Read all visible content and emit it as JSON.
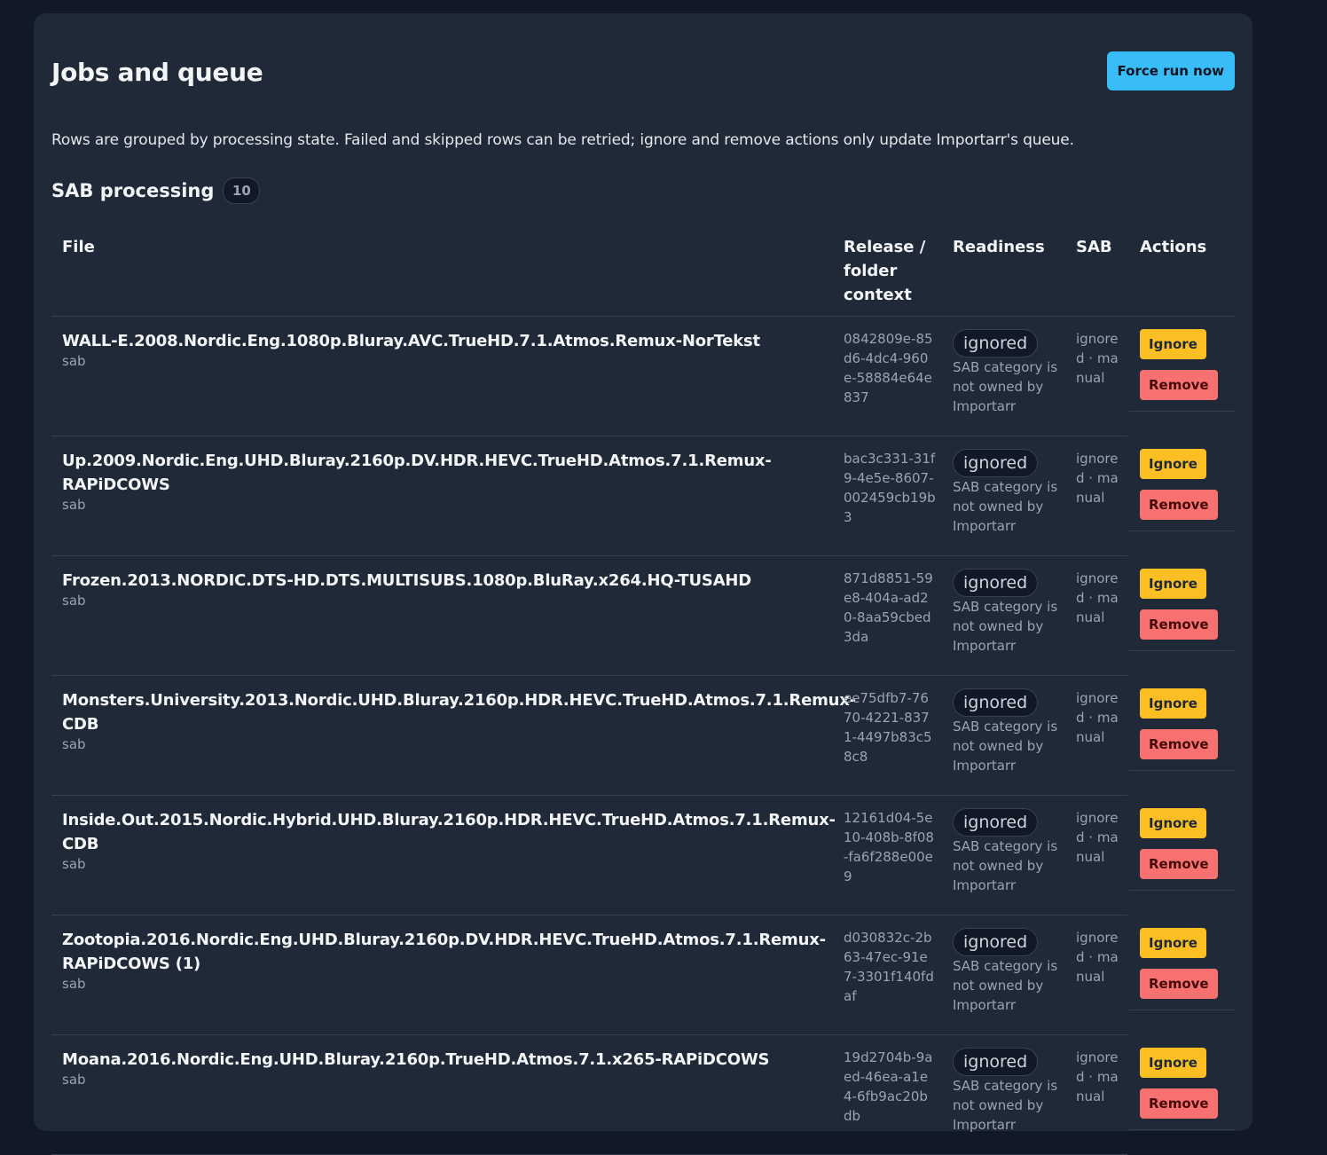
{
  "header": {
    "title": "Jobs and queue",
    "force_run_label": "Force run now"
  },
  "description": "Rows are grouped by processing state. Failed and skipped rows can be retried; ignore and remove actions only update Importarr's queue.",
  "section": {
    "title": "SAB processing",
    "count": "10"
  },
  "columns": {
    "file": "File",
    "release": "Release / folder context",
    "readiness": "Readiness",
    "sab": "SAB",
    "actions": "Actions"
  },
  "rows": [
    {
      "file": "WALL-E.2008.Nordic.Eng.1080p.Bluray.AVC.TrueHD.7.1.Atmos.Remux-NorTekst",
      "source": "sab",
      "release": "0842809e-85d6-4dc4-960e-58884e64e837",
      "status": "ignored",
      "reason": "SAB category is not owned by Importarr",
      "sab": "ignored · manual",
      "ignore_label": "Ignore",
      "remove_label": "Remove"
    },
    {
      "file": "Up.2009.Nordic.Eng.UHD.Bluray.2160p.DV.HDR.HEVC.TrueHD.Atmos.7.1.Remux-RAPiDCOWS",
      "source": "sab",
      "release": "bac3c331-31f9-4e5e-8607-002459cb19b3",
      "status": "ignored",
      "reason": "SAB category is not owned by Importarr",
      "sab": "ignored · manual",
      "ignore_label": "Ignore",
      "remove_label": "Remove"
    },
    {
      "file": "Frozen.2013.NORDIC.DTS-HD.DTS.MULTISUBS.1080p.BluRay.x264.HQ-TUSAHD",
      "source": "sab",
      "release": "871d8851-59e8-404a-ad20-8aa59cbed3da",
      "status": "ignored",
      "reason": "SAB category is not owned by Importarr",
      "sab": "ignored · manual",
      "ignore_label": "Ignore",
      "remove_label": "Remove"
    },
    {
      "file": "Monsters.University.2013.Nordic.UHD.Bluray.2160p.HDR.HEVC.TrueHD.Atmos.7.1.Remux-CDB",
      "source": "sab",
      "release": "ee75dfb7-7670-4221-8371-4497b83c58c8",
      "status": "ignored",
      "reason": "SAB category is not owned by Importarr",
      "sab": "ignored · manual",
      "ignore_label": "Ignore",
      "remove_label": "Remove"
    },
    {
      "file": "Inside.Out.2015.Nordic.Hybrid.UHD.Bluray.2160p.HDR.HEVC.TrueHD.Atmos.7.1.Remux-CDB",
      "source": "sab",
      "release": "12161d04-5e10-408b-8f08-fa6f288e00e9",
      "status": "ignored",
      "reason": "SAB category is not owned by Importarr",
      "sab": "ignored · manual",
      "ignore_label": "Ignore",
      "remove_label": "Remove"
    },
    {
      "file": "Zootopia.2016.Nordic.Eng.UHD.Bluray.2160p.DV.HDR.HEVC.TrueHD.Atmos.7.1.Remux-RAPiDCOWS (1)",
      "source": "sab",
      "release": "d030832c-2b63-47ec-91e7-3301f140fdaf",
      "status": "ignored",
      "reason": "SAB category is not owned by Importarr",
      "sab": "ignored · manual",
      "ignore_label": "Ignore",
      "remove_label": "Remove"
    },
    {
      "file": "Moana.2016.Nordic.Eng.UHD.Bluray.2160p.TrueHD.Atmos.7.1.x265-RAPiDCOWS",
      "source": "sab",
      "release": "19d2704b-9aed-46ea-a1e4-6fb9ac20bdb",
      "status": "ignored",
      "reason": "SAB category is not owned by Importarr",
      "sab": "ignored · manual",
      "ignore_label": "Ignore",
      "remove_label": "Remove"
    }
  ]
}
